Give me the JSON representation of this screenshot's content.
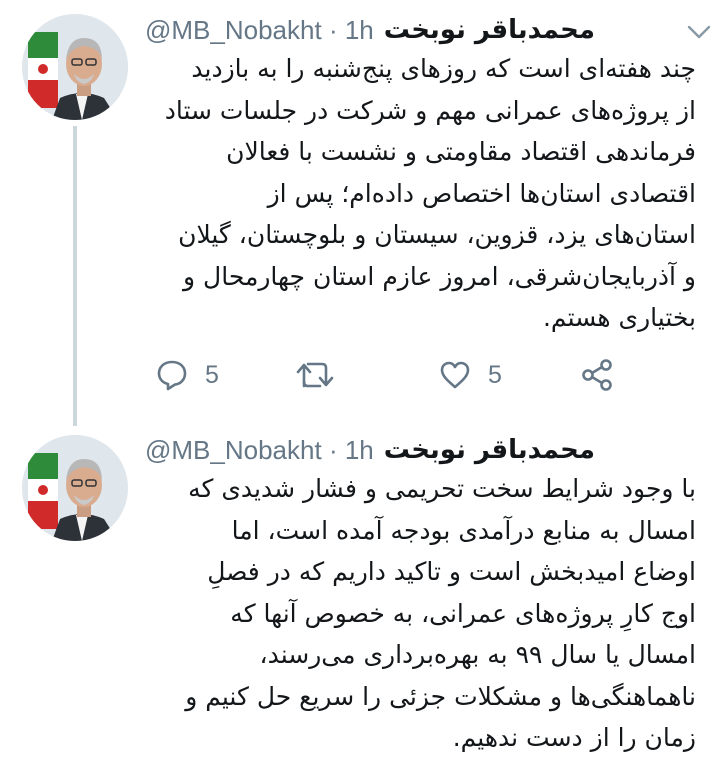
{
  "tweets": [
    {
      "author_name": "محمدباقر نوبخت",
      "handle": "@MB_Nobakht",
      "time": "1h",
      "separator": "·",
      "lines": [
        "چند هفته‌ای است که روزهای پنج‌شنبه را به بازدید",
        "از پروژه‌های عمرانی مهم و شرکت در جلسات ستاد",
        "فرماندهی اقتصاد مقاومتی و نشست با فعالان",
        "اقتصادی استان‌ها اختصاص داده‌ام؛ پس از",
        "استان‌های یزد، قزوین، سیستان و بلوچستان، گیلان",
        "و آذربایجان‌شرقی، امروز عازم استان چهارمحال و",
        "بختیاری هستم."
      ],
      "reply_count": "5",
      "like_count": "5"
    },
    {
      "author_name": "محمدباقر نوبخت",
      "handle": "@MB_Nobakht",
      "time": "1h",
      "separator": "·",
      "lines": [
        "با وجود شرایط سخت تحریمی و فشار شدیدی که",
        "امسال به منابع درآمدی بودجه آمده است، اما",
        "اوضاع امیدبخش است و تاکید داریم که در فصلِ",
        "اوج کارِ پروژه‌های عمرانی، به خصوص آنها که",
        "امسال یا سال ۹۹ به بهره‌برداری می‌رسند،",
        "ناهماهنگی‌ها و مشکلات جزئی را سریع حل کنیم و",
        "زمان را از دست ندهیم."
      ]
    }
  ],
  "icons": {
    "reply": "reply-icon",
    "retweet": "retweet-icon",
    "like": "like-icon",
    "share": "share-icon",
    "caret": "chevron-down-icon",
    "avatar": "avatar"
  },
  "colors": {
    "icon_gray": "#657786",
    "thread_line": "#ccd6dd",
    "text": "#14171a"
  }
}
